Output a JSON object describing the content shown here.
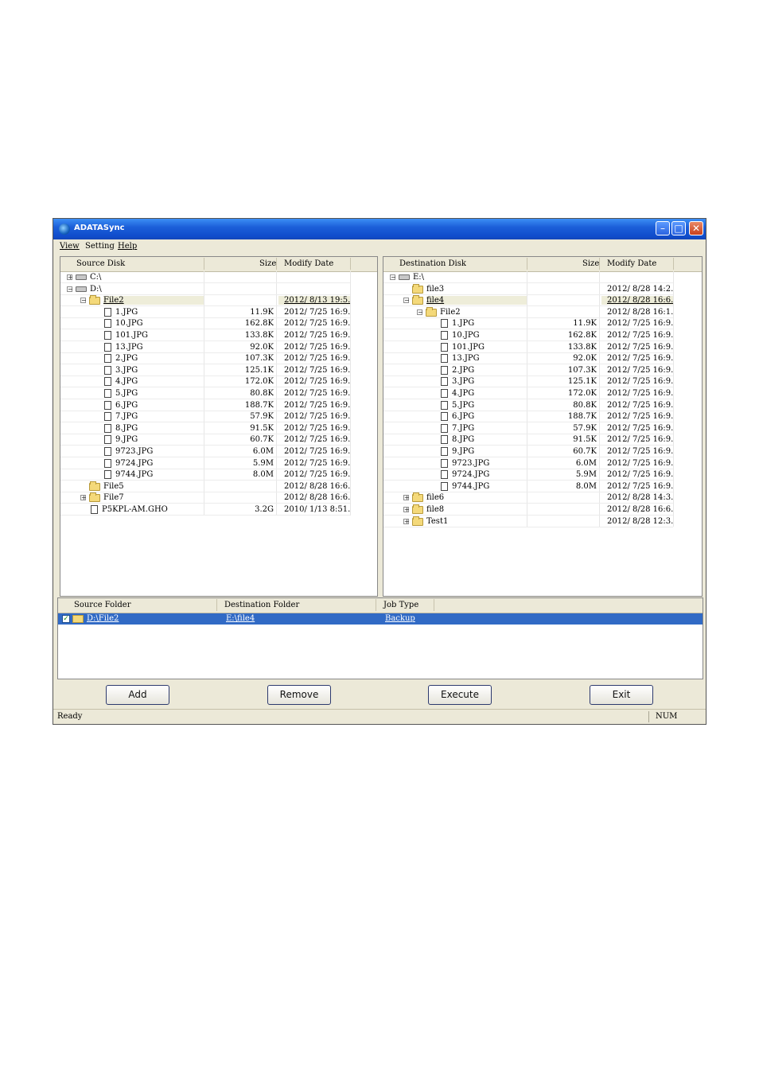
{
  "window": {
    "title": "ADATASync",
    "min_glyph": "–",
    "max_glyph": "□",
    "close_glyph": "✕"
  },
  "menu": [
    "View",
    "Setting",
    "Help"
  ],
  "source": {
    "headers": {
      "name": "Source Disk",
      "size": "Size",
      "date": "Modify Date"
    },
    "rows": [
      {
        "level": 0,
        "type": "drive",
        "expander": "+",
        "name": "C:\\",
        "size": "",
        "date": ""
      },
      {
        "level": 0,
        "type": "drive",
        "expander": "−",
        "name": "D:\\",
        "size": "",
        "date": ""
      },
      {
        "level": 1,
        "type": "folder",
        "expander": "−",
        "name": "File2",
        "size": "",
        "date": "2012/ 8/13 19:5...",
        "highlight": true
      },
      {
        "level": 2,
        "type": "file",
        "name": "1.JPG",
        "size": "11.9K",
        "date": "2012/ 7/25 16:9..."
      },
      {
        "level": 2,
        "type": "file",
        "name": "10.JPG",
        "size": "162.8K",
        "date": "2012/ 7/25 16:9..."
      },
      {
        "level": 2,
        "type": "file",
        "name": "101.JPG",
        "size": "133.8K",
        "date": "2012/ 7/25 16:9..."
      },
      {
        "level": 2,
        "type": "file",
        "name": "13.JPG",
        "size": "92.0K",
        "date": "2012/ 7/25 16:9..."
      },
      {
        "level": 2,
        "type": "file",
        "name": "2.JPG",
        "size": "107.3K",
        "date": "2012/ 7/25 16:9..."
      },
      {
        "level": 2,
        "type": "file",
        "name": "3.JPG",
        "size": "125.1K",
        "date": "2012/ 7/25 16:9..."
      },
      {
        "level": 2,
        "type": "file",
        "name": "4.JPG",
        "size": "172.0K",
        "date": "2012/ 7/25 16:9..."
      },
      {
        "level": 2,
        "type": "file",
        "name": "5.JPG",
        "size": "80.8K",
        "date": "2012/ 7/25 16:9..."
      },
      {
        "level": 2,
        "type": "file",
        "name": "6.JPG",
        "size": "188.7K",
        "date": "2012/ 7/25 16:9..."
      },
      {
        "level": 2,
        "type": "file",
        "name": "7.JPG",
        "size": "57.9K",
        "date": "2012/ 7/25 16:9..."
      },
      {
        "level": 2,
        "type": "file",
        "name": "8.JPG",
        "size": "91.5K",
        "date": "2012/ 7/25 16:9..."
      },
      {
        "level": 2,
        "type": "file",
        "name": "9.JPG",
        "size": "60.7K",
        "date": "2012/ 7/25 16:9..."
      },
      {
        "level": 2,
        "type": "file",
        "name": "9723.JPG",
        "size": "6.0M",
        "date": "2012/ 7/25 16:9..."
      },
      {
        "level": 2,
        "type": "file",
        "name": "9724.JPG",
        "size": "5.9M",
        "date": "2012/ 7/25 16:9..."
      },
      {
        "level": 2,
        "type": "file",
        "name": "9744.JPG",
        "size": "8.0M",
        "date": "2012/ 7/25 16:9..."
      },
      {
        "level": 1,
        "type": "folder",
        "name": "File5",
        "size": "",
        "date": "2012/ 8/28 16:6..."
      },
      {
        "level": 1,
        "type": "folder",
        "expander": "+",
        "name": "File7",
        "size": "",
        "date": "2012/ 8/28 16:6..."
      },
      {
        "level": 1,
        "type": "file",
        "name": "P5KPL-AM.GHO",
        "size": "3.2G",
        "date": "2010/ 1/13 8:51..."
      }
    ]
  },
  "destination": {
    "headers": {
      "name": "Destination Disk",
      "size": "Size",
      "date": "Modify Date"
    },
    "rows": [
      {
        "level": 0,
        "type": "drive",
        "expander": "−",
        "name": "E:\\",
        "size": "",
        "date": ""
      },
      {
        "level": 1,
        "type": "folder",
        "name": "file3",
        "size": "",
        "date": "2012/ 8/28 14:2..."
      },
      {
        "level": 1,
        "type": "folder",
        "expander": "−",
        "name": "file4",
        "size": "",
        "date": "2012/ 8/28 16:6...",
        "highlight": true
      },
      {
        "level": 2,
        "type": "folder",
        "expander": "−",
        "name": "File2",
        "size": "",
        "date": "2012/ 8/28 16:1..."
      },
      {
        "level": 3,
        "type": "file",
        "name": "1.JPG",
        "size": "11.9K",
        "date": "2012/ 7/25 16:9..."
      },
      {
        "level": 3,
        "type": "file",
        "name": "10.JPG",
        "size": "162.8K",
        "date": "2012/ 7/25 16:9..."
      },
      {
        "level": 3,
        "type": "file",
        "name": "101.JPG",
        "size": "133.8K",
        "date": "2012/ 7/25 16:9..."
      },
      {
        "level": 3,
        "type": "file",
        "name": "13.JPG",
        "size": "92.0K",
        "date": "2012/ 7/25 16:9..."
      },
      {
        "level": 3,
        "type": "file",
        "name": "2.JPG",
        "size": "107.3K",
        "date": "2012/ 7/25 16:9..."
      },
      {
        "level": 3,
        "type": "file",
        "name": "3.JPG",
        "size": "125.1K",
        "date": "2012/ 7/25 16:9..."
      },
      {
        "level": 3,
        "type": "file",
        "name": "4.JPG",
        "size": "172.0K",
        "date": "2012/ 7/25 16:9..."
      },
      {
        "level": 3,
        "type": "file",
        "name": "5.JPG",
        "size": "80.8K",
        "date": "2012/ 7/25 16:9..."
      },
      {
        "level": 3,
        "type": "file",
        "name": "6.JPG",
        "size": "188.7K",
        "date": "2012/ 7/25 16:9..."
      },
      {
        "level": 3,
        "type": "file",
        "name": "7.JPG",
        "size": "57.9K",
        "date": "2012/ 7/25 16:9..."
      },
      {
        "level": 3,
        "type": "file",
        "name": "8.JPG",
        "size": "91.5K",
        "date": "2012/ 7/25 16:9..."
      },
      {
        "level": 3,
        "type": "file",
        "name": "9.JPG",
        "size": "60.7K",
        "date": "2012/ 7/25 16:9..."
      },
      {
        "level": 3,
        "type": "file",
        "name": "9723.JPG",
        "size": "6.0M",
        "date": "2012/ 7/25 16:9..."
      },
      {
        "level": 3,
        "type": "file",
        "name": "9724.JPG",
        "size": "5.9M",
        "date": "2012/ 7/25 16:9..."
      },
      {
        "level": 3,
        "type": "file",
        "name": "9744.JPG",
        "size": "8.0M",
        "date": "2012/ 7/25 16:9..."
      },
      {
        "level": 1,
        "type": "folder",
        "expander": "+",
        "name": "file6",
        "size": "",
        "date": "2012/ 8/28 14:3..."
      },
      {
        "level": 1,
        "type": "folder",
        "expander": "+",
        "name": "file8",
        "size": "",
        "date": "2012/ 8/28 16:6..."
      },
      {
        "level": 1,
        "type": "folder",
        "expander": "+",
        "name": "Test1",
        "size": "",
        "date": "2012/ 8/28 12:3..."
      }
    ]
  },
  "jobs": {
    "headers": {
      "source": "Source Folder",
      "dest": "Destination Folder",
      "type": "Job Type"
    },
    "rows": [
      {
        "checked": true,
        "source": "D:\\File2",
        "dest": "E:\\file4",
        "type": "Backup"
      }
    ],
    "check_glyph": "✓"
  },
  "buttons": {
    "add": "Add",
    "remove": "Remove",
    "execute": "Execute",
    "exit": "Exit"
  },
  "status": {
    "text": "Ready",
    "num": "NUM"
  }
}
